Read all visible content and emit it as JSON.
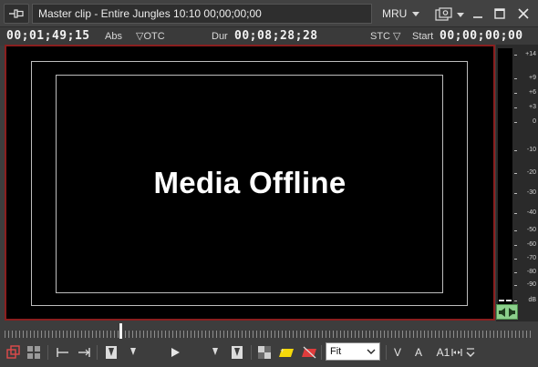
{
  "window": {
    "title": "Master clip - Entire Jungles   10:10 00;00;00;00",
    "mru_label": "MRU",
    "buttons": [
      "pin-icon",
      "settings-icon",
      "minimize-icon",
      "maximize-icon",
      "close-icon"
    ]
  },
  "timecodes": {
    "position": "00;01;49;15",
    "position_mode": "Abs",
    "otc_label": "▽OTC",
    "duration_label": "Dur",
    "duration": "00;08;28;28",
    "stc_label": "STC ▽",
    "start_label": "Start",
    "start": "00;00;00;00"
  },
  "viewer": {
    "message": "Media Offline",
    "border_color": "#8a1f1f"
  },
  "audio_meter": {
    "scale": [
      "+14",
      "+9",
      "+6",
      "+3",
      "0",
      "-10",
      "-20",
      "-30",
      "-40",
      "-50",
      "-60",
      "-70",
      "-80",
      "-90",
      "dB"
    ],
    "speaker_color": "#8cd08c"
  },
  "toolbar": {
    "zoom_select": "Fit",
    "video_label": "V",
    "audio_label": "A",
    "channel_label": "A1",
    "marker_yellow": "#f5d90a",
    "marker_red": "#e03c3c",
    "accent_red": "#e04a4a"
  }
}
